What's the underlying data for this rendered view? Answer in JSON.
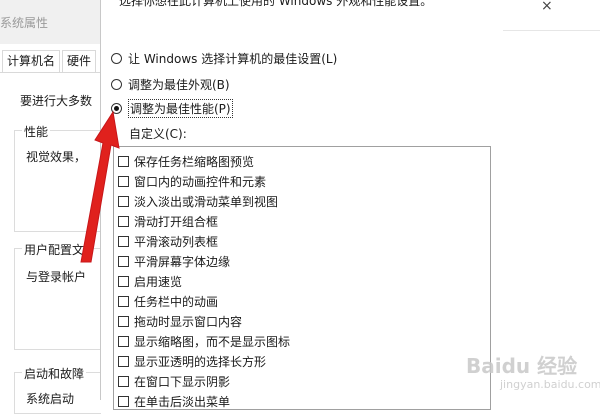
{
  "background_window": {
    "title": "系统属性",
    "tabs": [
      "计算机名",
      "硬件"
    ],
    "intro_text": "要进行大多数",
    "performance_group": {
      "label": "性能",
      "text": "视觉效果，"
    },
    "user_profile_group": {
      "label": "用户配置文",
      "text": "与登录帐户"
    },
    "startup_group": {
      "label": "启动和故障",
      "text": "系统启动"
    }
  },
  "dialog": {
    "top_text": "选择你想在此计算机上使用的 Windows 外观和性能设置。",
    "radio_options": [
      {
        "label": "让 Windows 选择计算机的最佳设置(L)",
        "checked": false
      },
      {
        "label": "调整为最佳外观(B)",
        "checked": false
      },
      {
        "label": "调整为最佳性能(P)",
        "checked": true
      }
    ],
    "custom_label": "自定义(C):",
    "checkbox_items": [
      "保存任务栏缩略图预览",
      "窗口内的动画控件和元素",
      "淡入淡出或滑动菜单到视图",
      "滑动打开组合框",
      "平滑滚动列表框",
      "平滑屏幕字体边缘",
      "启用速览",
      "任务栏中的动画",
      "拖动时显示窗口内容",
      "显示缩略图，而不是显示图标",
      "显示亚透明的选择长方形",
      "在窗口下显示阴影",
      "在单击后淡出菜单"
    ]
  },
  "right_window": {
    "close_glyph": "×"
  },
  "annotation": {
    "arrow_color": "#e0211d"
  },
  "watermark": {
    "brand": "Baidu 经验",
    "sub": "jingyan.baidu.com"
  }
}
